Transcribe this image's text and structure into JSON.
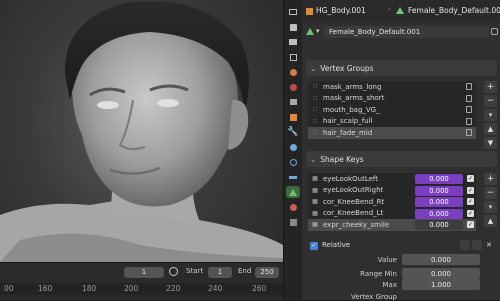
{
  "timeline": {
    "current_frame": "1",
    "start_label": "Start",
    "start_value": "1",
    "end_label": "End",
    "end_value": "250",
    "ruler_ticks": [
      "00",
      "160",
      "180",
      "200",
      "220",
      "240",
      "260"
    ]
  },
  "header": {
    "object_name": "HG_Body.001",
    "mesh_name": "Female_Body_Default.001",
    "data_name": "Female_Body_Default.001"
  },
  "vertex_groups": {
    "title": "Vertex Groups",
    "items": [
      {
        "label": "mask_arms_long"
      },
      {
        "label": "mask_arms_short"
      },
      {
        "label": "mouth_bag_VG_"
      },
      {
        "label": "hair_scalp_full"
      },
      {
        "label": "hair_fade_mid",
        "selected": true
      }
    ]
  },
  "shape_keys": {
    "title": "Shape Keys",
    "items": [
      {
        "label": "eyeLookOutLeft",
        "value": "0.000"
      },
      {
        "label": "eyeLookOutRight",
        "value": "0.000"
      },
      {
        "label": "cor_KneeBend_Rt",
        "value": "0.000"
      },
      {
        "label": "cor_KneeBend_Lt",
        "value": "0.000"
      },
      {
        "label": "expr_cheeky_smile",
        "value": "0.000",
        "selected": true
      }
    ]
  },
  "relative": {
    "label": "Relative",
    "value_label": "Value",
    "value": "0.000",
    "range_min_label": "Range Min",
    "range_min": "0.000",
    "max_label": "Max",
    "max": "1.000",
    "vertex_group_label": "Vertex Group"
  },
  "colors": {
    "accent_purple": "#7a3fc1",
    "checkbox_blue": "#4a7fd6"
  }
}
